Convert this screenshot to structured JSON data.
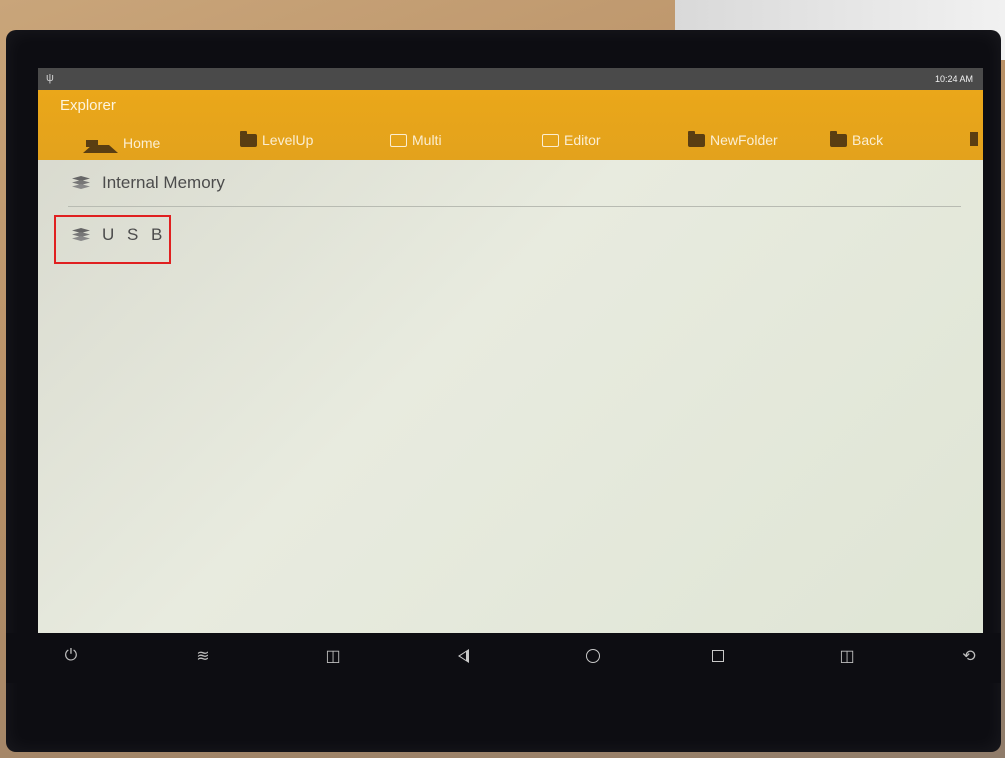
{
  "status_bar": {
    "usb_icon": "usb-icon",
    "time": "10:24 AM"
  },
  "app": {
    "title": "Explorer",
    "accent_color": "#e8a51d"
  },
  "toolbar": [
    {
      "label": "Home",
      "icon": "home-icon"
    },
    {
      "label": "LevelUp",
      "icon": "level-up-icon"
    },
    {
      "label": "Multi",
      "icon": "multi-select-icon"
    },
    {
      "label": "Editor",
      "icon": "editor-icon"
    },
    {
      "label": "NewFolder",
      "icon": "new-folder-icon"
    },
    {
      "label": "Back",
      "icon": "back-icon"
    }
  ],
  "storage_list": [
    {
      "label": "Internal Memory",
      "icon": "storage-stack-icon"
    },
    {
      "label": "U S B",
      "icon": "storage-stack-icon",
      "highlighted": true
    }
  ],
  "nav_bar": [
    {
      "name": "power-icon",
      "glyph": "⏻"
    },
    {
      "name": "double-chevron-down-icon",
      "glyph": "≋"
    },
    {
      "name": "volume-down-icon",
      "glyph": "🔈"
    },
    {
      "name": "back-triangle-icon",
      "glyph": ""
    },
    {
      "name": "home-circle-icon",
      "glyph": ""
    },
    {
      "name": "recents-square-icon",
      "glyph": ""
    },
    {
      "name": "volume-up-icon",
      "glyph": "🔉"
    },
    {
      "name": "screen-rotate-icon",
      "glyph": "⟲"
    }
  ]
}
